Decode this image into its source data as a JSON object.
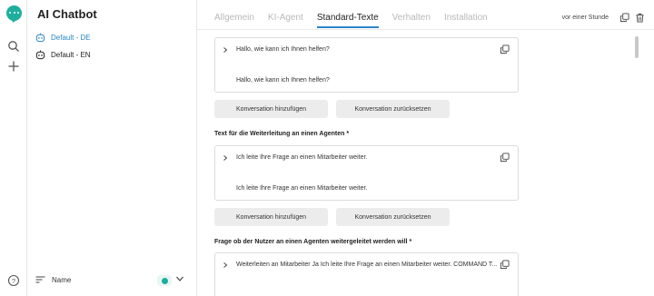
{
  "app": {
    "title": "AI Chatbot"
  },
  "sidebar": {
    "items": [
      {
        "label": "Default - DE",
        "active": true
      },
      {
        "label": "Default - EN",
        "active": false
      }
    ],
    "sort_label": "Name"
  },
  "tabs": [
    {
      "label": "Allgemein",
      "active": false
    },
    {
      "label": "KI-Agent",
      "active": false
    },
    {
      "label": "Standard-Texte",
      "active": true
    },
    {
      "label": "Verhalten",
      "active": false
    },
    {
      "label": "Installation",
      "active": false
    }
  ],
  "header": {
    "timestamp": "vor einer Stunde"
  },
  "sections": [
    {
      "label": "",
      "row1": "Hallo, wie kann ich Ihnen helfen?",
      "row2": "Hallo, wie kann ich Ihnen helfen?",
      "add_button": "Konversation hinzufügen",
      "reset_button": "Konversation zurücksetzen"
    },
    {
      "label": "Text für die Weiterleitung an einen Agenten *",
      "row1": "Ich leite Ihre Frage an einen Mitarbeiter weiter.",
      "row2": "Ich leite Ihre Frage an einen Mitarbeiter weiter.",
      "add_button": "Konversation hinzufügen",
      "reset_button": "Konversation zurücksetzen"
    },
    {
      "label": "Frage ob der Nutzer an einen Agenten weitergeleitet werden will *",
      "row1": "Weiterleiten an Mitarbeiter Ja Ich leite Ihre Frage an einen Mitarbeiter weiter. COMMAND T..."
    }
  ],
  "colors": {
    "accent": "#2b87c9",
    "brand": "#1fae9e"
  },
  "icons": {
    "logo": "chat-bubble-icon",
    "search": "search-icon",
    "add": "plus-icon",
    "help": "help-circle-icon",
    "bot": "bot-icon",
    "sort": "sort-lines-icon",
    "copy": "copy-icon",
    "trash": "trash-icon",
    "caret": "chevron-right-icon",
    "chevron_down": "chevron-down-icon"
  }
}
